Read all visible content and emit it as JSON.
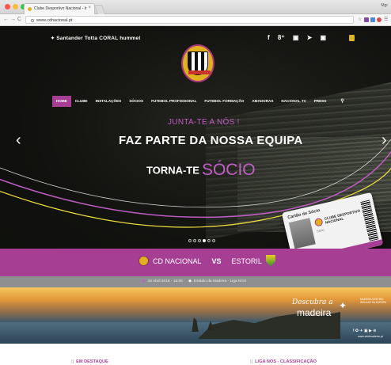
{
  "browser": {
    "tab_title": "Clube Desportivo Nacional - Ir",
    "tab_close": "×",
    "user": "Mgr",
    "url": "www.cdnacional.pt",
    "nav_back": "←",
    "nav_forward": "→",
    "nav_reload": "C",
    "star": "☆",
    "menu": "☰"
  },
  "header": {
    "sponsors": "Santander Totta  CORAL  hummel",
    "social": [
      "f",
      "8⁺",
      "▣",
      "➤",
      "▣"
    ]
  },
  "nav": {
    "items": [
      {
        "label": "HOME",
        "active": true
      },
      {
        "label": "CLUBE",
        "active": false
      },
      {
        "label": "INSTALAÇÕES",
        "active": false
      },
      {
        "label": "SÓCIOS",
        "active": false
      },
      {
        "label": "FUTEBOL PROFISSIONAL",
        "active": false
      },
      {
        "label": "FUTEBOL FORMAÇÃO",
        "active": false
      },
      {
        "label": "AMADORAS",
        "active": false
      },
      {
        "label": "NACIONAL TV",
        "active": false
      },
      {
        "label": "PRESS",
        "active": false
      }
    ],
    "search_icon": "magnifier"
  },
  "hero": {
    "line1": "JUNTA-TE A NÓS !",
    "line2": "FAZ PARTE DA NOSSA EQUIPA",
    "line3a": "TORNA-TE",
    "line3b": "SÓCIO",
    "prev": "‹",
    "next": "›",
    "slide_count": 6,
    "active_slide": 4,
    "card": {
      "title": "Cartão de Sócio",
      "club": "CLUBE DESPORTIVO NACIONAL",
      "number": "Sócio"
    }
  },
  "match": {
    "home": "CD NACIONAL",
    "vs": "VS",
    "away": "ESTORIL"
  },
  "match_info": {
    "date": "26 Abril 2016 - 16:00",
    "venue": "Estádio da Madeira - Liga NOS"
  },
  "banner": {
    "line1": "Descubra a",
    "line2": "madeira",
    "seal": "MADEIRA DESTINO INSULAR DA EUROPA",
    "social": "f  ✪  ✈  ▣  ▶  ⊕",
    "url": "www.visitmadeira.pt"
  },
  "sections": {
    "left": "EM DESTAQUE",
    "right": "LIGA NOS - CLASSIFICAÇÃO"
  },
  "colors": {
    "brand_purple": "#a63f94",
    "accent_pink": "#c05ec4",
    "club_gold": "#e0b021"
  }
}
